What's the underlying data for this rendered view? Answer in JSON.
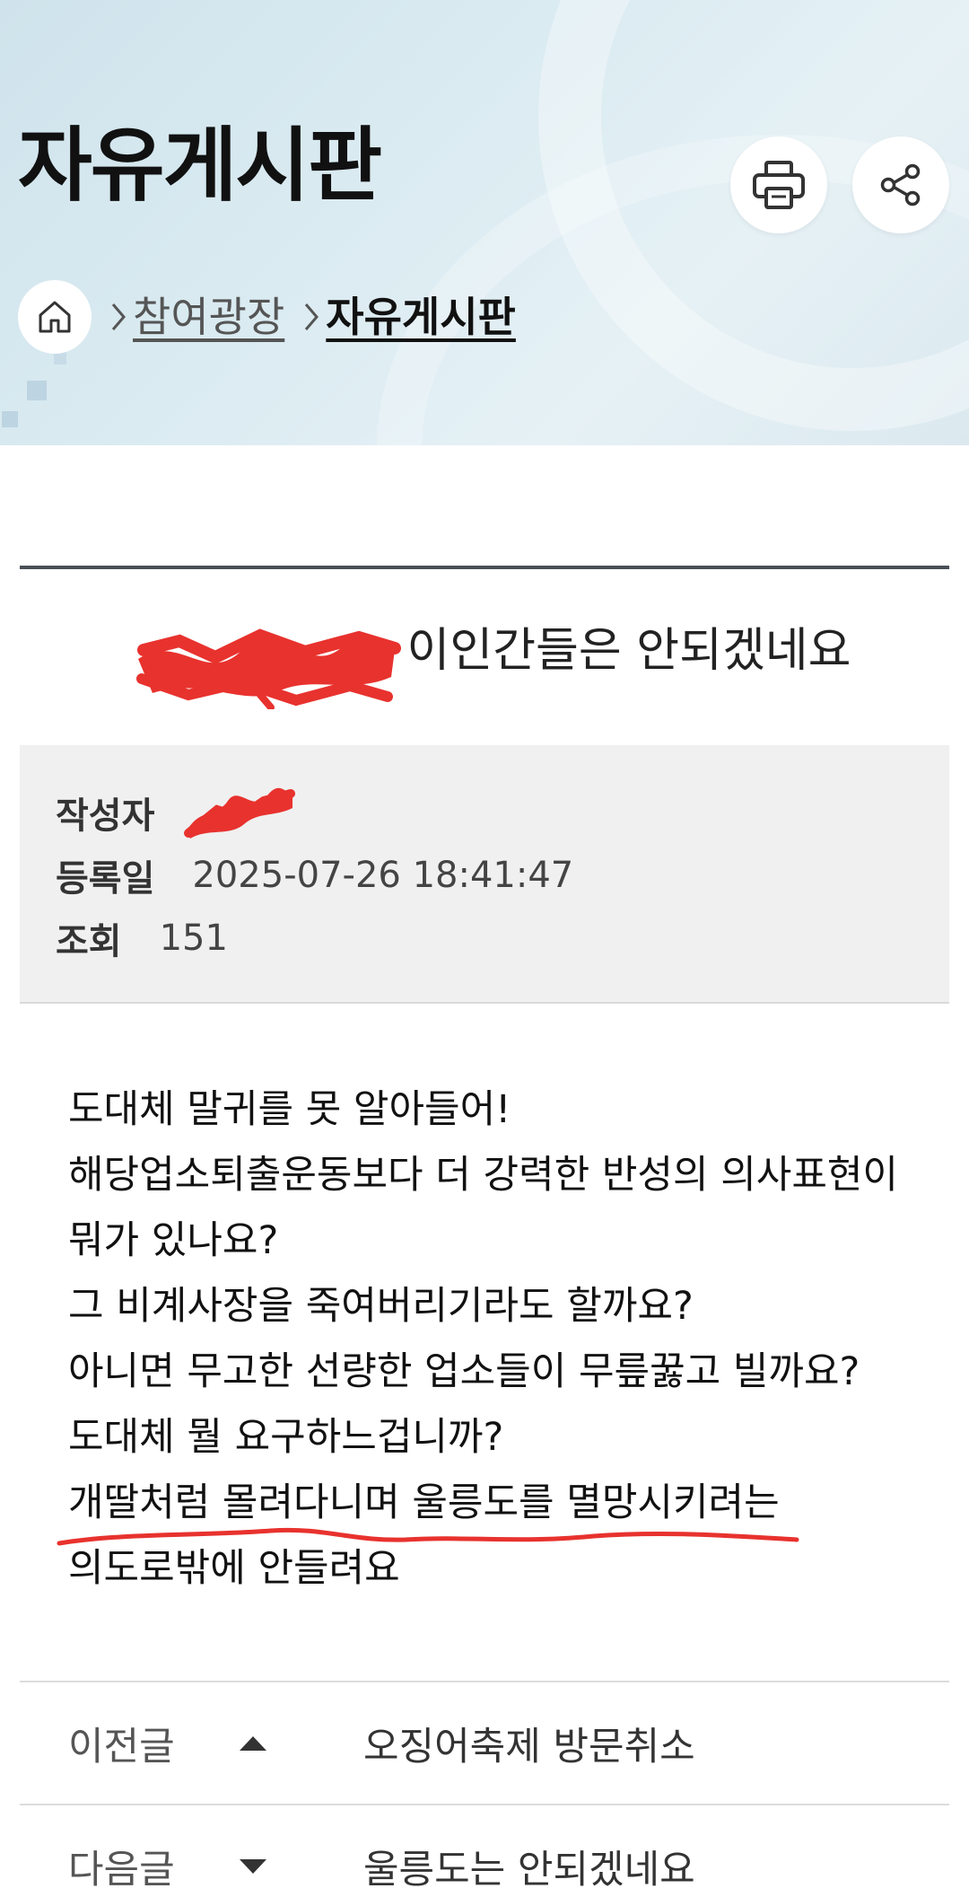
{
  "header": {
    "title": "자유게시판",
    "print_icon": "print-icon",
    "share_icon": "share-icon"
  },
  "breadcrumb": {
    "home_icon": "home-icon",
    "items": [
      "참여광장",
      "자유게시판"
    ]
  },
  "post": {
    "title_visible": "이인간들은 안되겠네요",
    "meta": {
      "author_label": "작성자",
      "date_label": "등록일",
      "date_value": "2025-07-26 18:41:47",
      "views_label": "조회",
      "views_value": "151"
    },
    "body": [
      "도대체 말귀를 못 알아들어!",
      "해당업소퇴출운동보다 더 강력한 반성의 의사표현이",
      "뭐가 있나요?",
      "그 비계사장을 죽여버리기라도 할까요?",
      "아니면 무고한 선량한 업소들이 무릎꿇고 빌까요?",
      "도대체 뭘 요구하느겁니까?",
      "개딸처럼 몰려다니며 울릉도를 멸망시키려는",
      "의도로밖에 안들려요"
    ]
  },
  "nav": {
    "prev_label": "이전글",
    "prev_title": "오징어축제 방문취소",
    "next_label": "다음글",
    "next_title": "울릉도는 안되겠네요"
  },
  "colors": {
    "banner": "#d9eaf1",
    "redaction": "#e8322e",
    "rule": "#4a4f57",
    "meta_bg": "#f0f0f0"
  }
}
